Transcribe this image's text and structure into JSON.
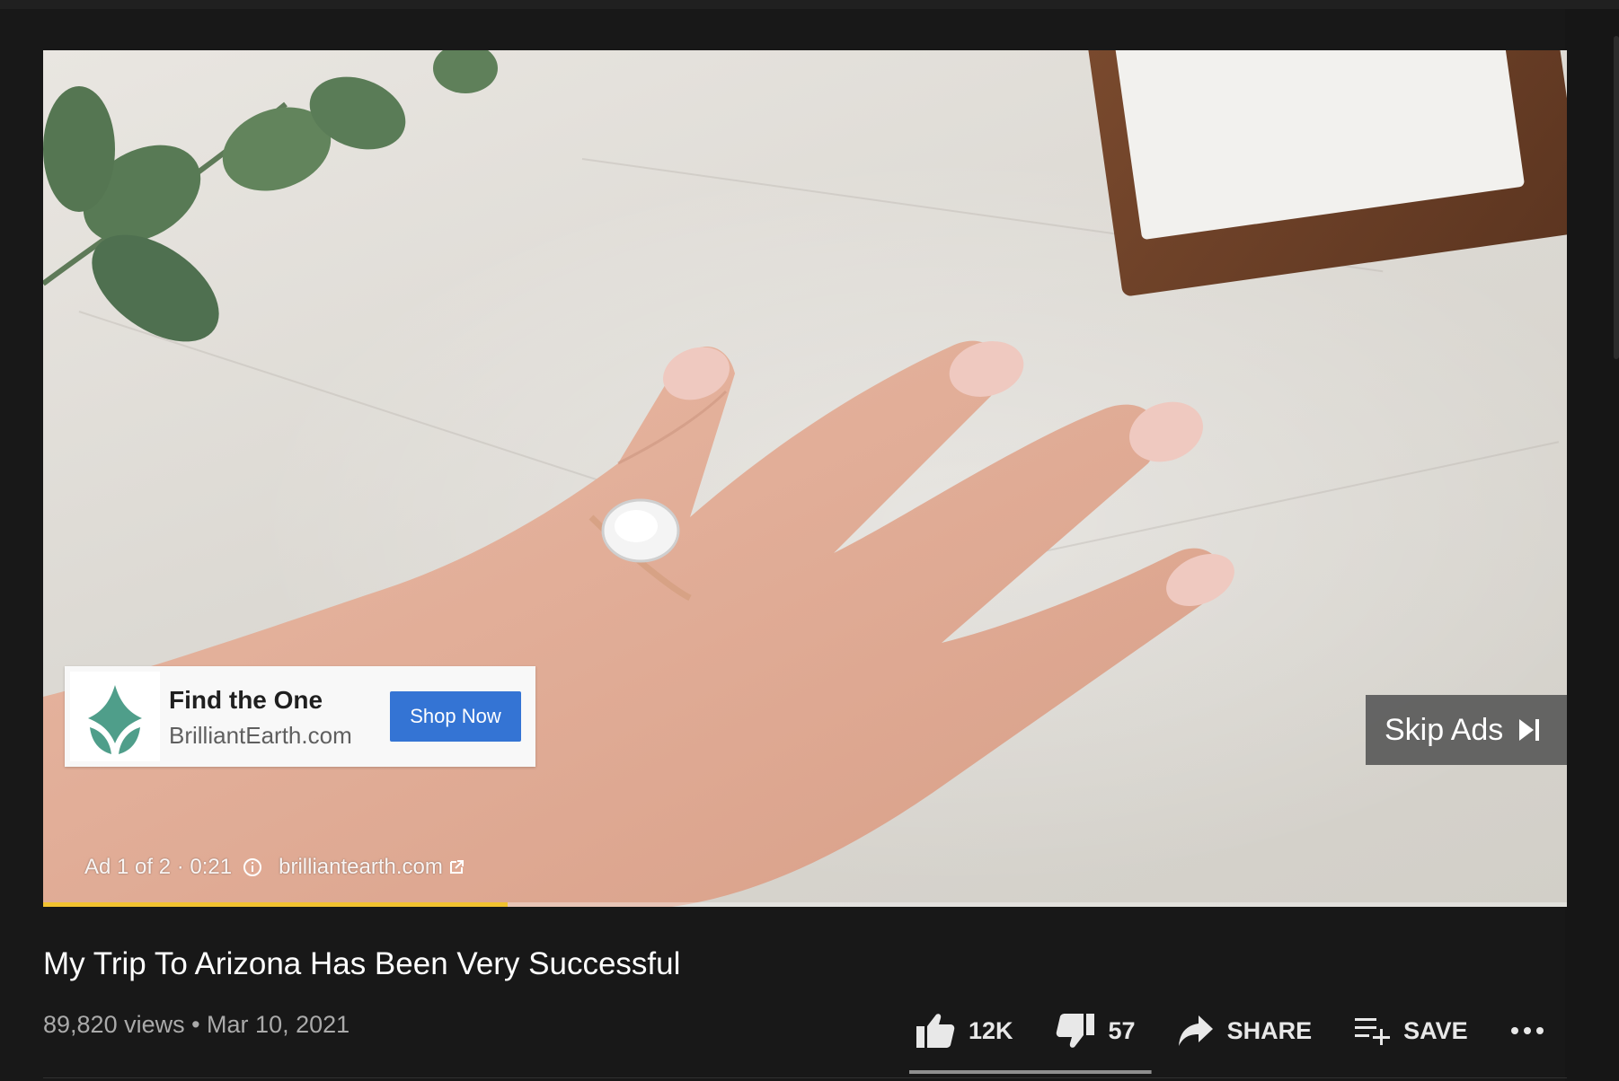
{
  "ad": {
    "card_title": "Find the One",
    "card_domain": "BrilliantEarth.com",
    "cta_label": "Shop Now",
    "skip_label": "Skip Ads",
    "info_label": "Ad 1 of 2 · 0:21",
    "info_domain": "brilliantearth.com",
    "progress_fraction": 0.305,
    "progress_color": "#f2c230",
    "cta_color": "#3474d4",
    "logo_color": "#4f9e8a"
  },
  "video": {
    "title": "My Trip To Arizona Has Been Very Successful",
    "meta": "89,820 views • Mar 10, 2021"
  },
  "actions": {
    "like_count": "12K",
    "dislike_count": "57",
    "share_label": "SHARE",
    "save_label": "SAVE",
    "like_ratio": 0.995
  },
  "icons": [
    "thumb-up-icon",
    "thumb-down-icon",
    "share-icon",
    "playlist-add-icon",
    "more-icon",
    "skip-next-icon",
    "info-icon",
    "external-link-icon",
    "brilliant-earth-logo-icon"
  ]
}
